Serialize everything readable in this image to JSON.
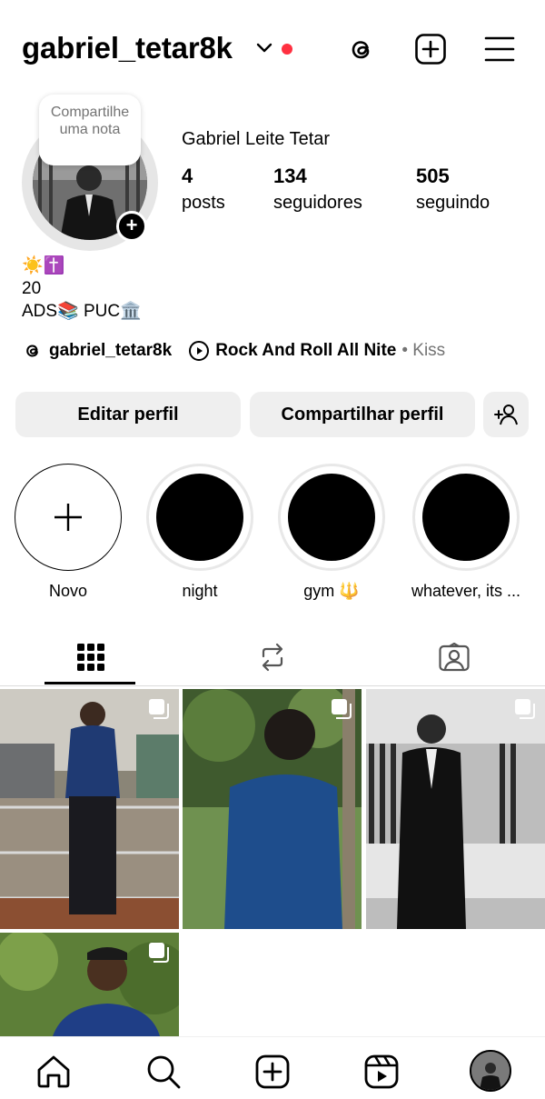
{
  "header": {
    "username": "gabriel_tetar8k",
    "icons": [
      "chevron-down-icon",
      "threads-icon",
      "new-post-icon",
      "menu-icon"
    ],
    "notification_dot_color": "#ff3040"
  },
  "profile": {
    "note_text": "Compartilhe uma nota",
    "display_name": "Gabriel Leite Tetar",
    "stats": [
      {
        "value": "4",
        "label": "posts"
      },
      {
        "value": "134",
        "label": "seguidores"
      },
      {
        "value": "505",
        "label": "seguindo"
      }
    ],
    "bio_lines": [
      "☀️✝️",
      "20",
      "ADS📚 PUC🏛️"
    ],
    "threads_handle": "gabriel_tetar8k",
    "music_title": "Rock And Roll All Nite",
    "music_artist": "• Kiss"
  },
  "actions": {
    "edit_profile": "Editar perfil",
    "share_profile": "Compartilhar perfil",
    "discover_icon": "add-person-icon"
  },
  "highlights": [
    {
      "label": "Novo"
    },
    {
      "label": "night"
    },
    {
      "label": "gym 🔱"
    },
    {
      "label": "whatever, its ..."
    }
  ],
  "tabs": [
    "grid-icon",
    "reposts-icon",
    "tagged-icon"
  ],
  "posts": [
    {
      "scene": "mall",
      "multi": true
    },
    {
      "scene": "garden",
      "multi": true
    },
    {
      "scene": "suit-store",
      "multi": true
    },
    {
      "scene": "selfie-plants",
      "multi": true
    }
  ],
  "bottom_nav": [
    "home-icon",
    "search-icon",
    "create-icon",
    "reels-icon",
    "profile-avatar"
  ]
}
